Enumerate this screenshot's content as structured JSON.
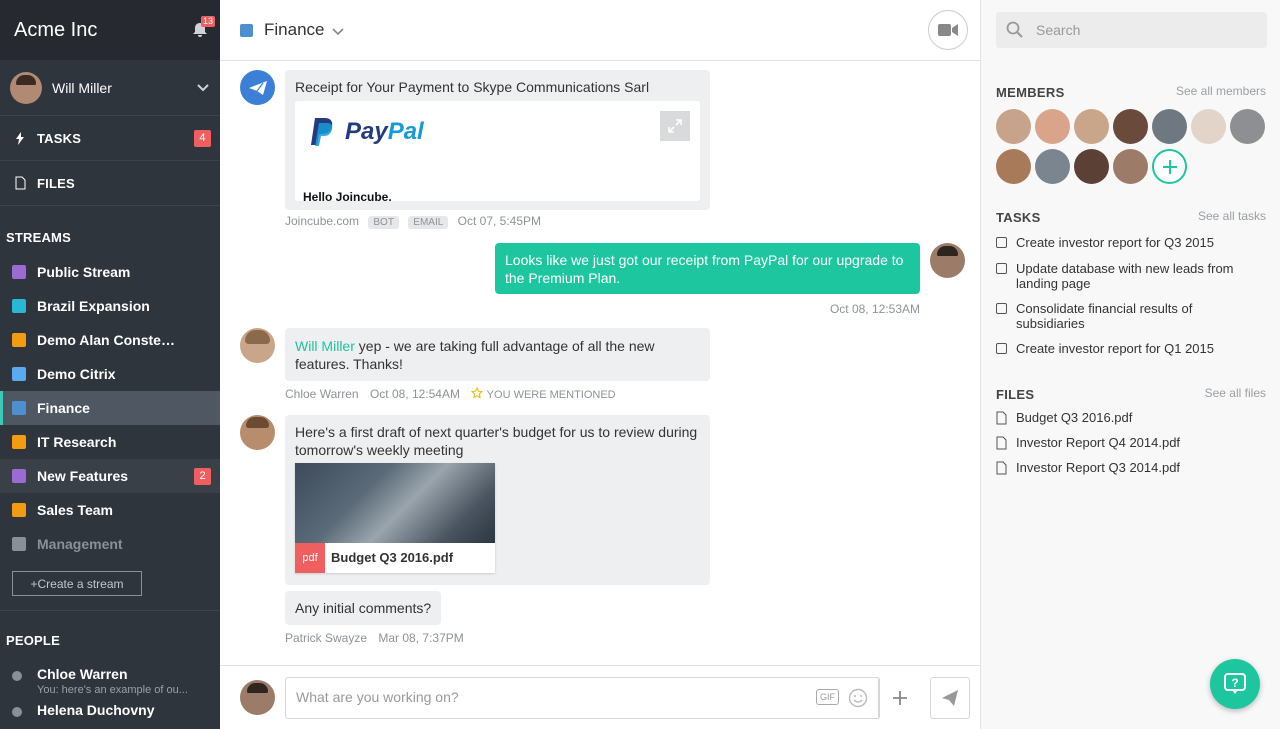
{
  "app": {
    "name": "Acme Inc",
    "notif_count": "13"
  },
  "user": {
    "name": "Will Miller"
  },
  "nav": {
    "tasks_label": "TASKS",
    "tasks_count": "4",
    "files_label": "FILES"
  },
  "streams": {
    "title": "STREAMS",
    "items": [
      {
        "label": "Public Stream",
        "color": "#9b6bd3"
      },
      {
        "label": "Brazil Expansion",
        "color": "#29b7d3"
      },
      {
        "label": "Demo Alan Conste…",
        "color": "#f39c12"
      },
      {
        "label": "Demo Citrix",
        "color": "#5baaf0"
      },
      {
        "label": "Finance",
        "color": "#4e8fcf"
      },
      {
        "label": "IT Research",
        "color": "#f39c12"
      },
      {
        "label": "New Features",
        "color": "#9b6bd3",
        "badge": "2"
      },
      {
        "label": "Sales Team",
        "color": "#f39c12"
      },
      {
        "label": "Management",
        "color": "#8a9097"
      }
    ],
    "create_label": "+Create a stream"
  },
  "people": {
    "title": "PEOPLE",
    "items": [
      {
        "name": "Chloe Warren",
        "preview": "You: here's an example of ou..."
      },
      {
        "name": "Helena Duchovny",
        "preview": ""
      }
    ]
  },
  "channel": {
    "name": "Finance",
    "color": "#4e8fcf"
  },
  "messages": {
    "m1": {
      "text": "Receipt for Your Payment to Skype Communications Sarl",
      "paypal_a": "Pay",
      "paypal_b": "Pal",
      "greeting": "Hello Joincube,",
      "sender": "Joincube.com",
      "tag1": "BOT",
      "tag2": "EMAIL",
      "time": "Oct 07, 5:45PM"
    },
    "m2": {
      "text": "Looks like we just got our receipt from PayPal for our upgrade to the Premium Plan.",
      "time": "Oct 08, 12:53AM"
    },
    "m3": {
      "mention": "Will Miller",
      "text": " yep - we are taking full advantage of all the new features. Thanks!",
      "sender": "Chloe Warren",
      "time": "Oct 08, 12:54AM",
      "note": "YOU WERE MENTIONED"
    },
    "m4": {
      "text": "Here's a first draft of next quarter's budget for us to review during tomorrow's weekly meeting",
      "file_type": "pdf",
      "file_name": "Budget Q3 2016.pdf",
      "text2": "Any initial comments?",
      "sender": "Patrick Swayze",
      "time": "Mar 08, 7:37PM"
    }
  },
  "composer": {
    "placeholder": "What are you working on?",
    "gif": "GIF"
  },
  "right": {
    "search_placeholder": "Search",
    "members_title": "MEMBERS",
    "members_link": "See all members",
    "tasks_title": "TASKS",
    "tasks_link": "See all tasks",
    "tasks": [
      "Create investor report for Q3 2015",
      "Update database with new leads from landing page",
      "Consolidate financial results of subsidiaries",
      "Create investor report for Q1 2015"
    ],
    "files_title": "FILES",
    "files_link": "See all files",
    "files": [
      "Budget Q3 2016.pdf",
      "Investor Report Q4 2014.pdf",
      "Investor Report Q3 2014.pdf"
    ]
  },
  "colors": {
    "accent": "#1ec6a0",
    "sidebar": "#2f353d",
    "badge": "#ef5f5f"
  }
}
